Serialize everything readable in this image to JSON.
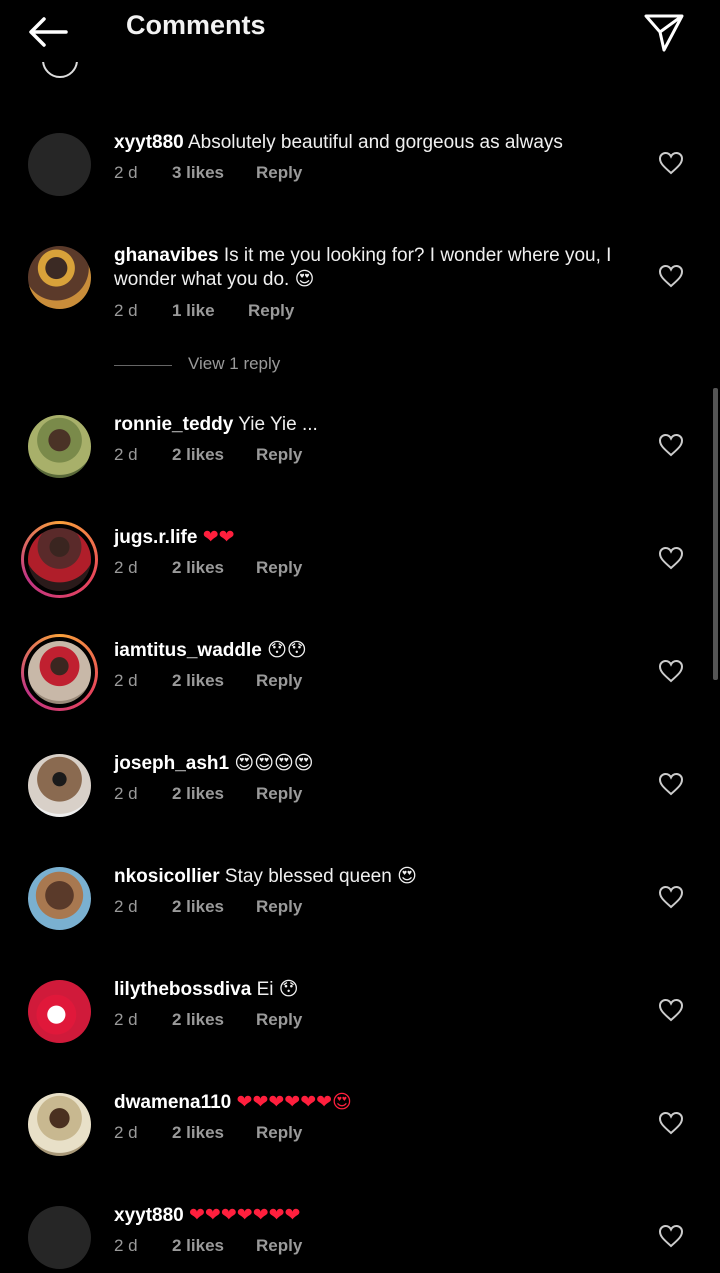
{
  "header": {
    "title": "Comments"
  },
  "view_replies_label": "View 1 reply",
  "comments": [
    {
      "user": "xyyt880",
      "text": "Absolutely beautiful and gorgeous as always",
      "time": "2 d",
      "likes": "3 likes",
      "reply": "Reply"
    },
    {
      "user": "ghanavibes",
      "text": "Is it me you looking for? I wonder where you, I wonder what you do. 😍",
      "time": "2 d",
      "likes": "1 like",
      "reply": "Reply"
    },
    {
      "user": "ronnie_teddy",
      "text": "Yie Yie ...",
      "time": "2 d",
      "likes": "2 likes",
      "reply": "Reply"
    },
    {
      "user": "jugs.r.life",
      "text": "❤❤",
      "time": "2 d",
      "likes": "2 likes",
      "reply": "Reply"
    },
    {
      "user": "iamtitus_waddle",
      "text": "😯😯",
      "time": "2 d",
      "likes": "2 likes",
      "reply": "Reply"
    },
    {
      "user": "joseph_ash1",
      "text": "😍😍😍😍",
      "time": "2 d",
      "likes": "2 likes",
      "reply": "Reply"
    },
    {
      "user": "nkosicollier",
      "text": "Stay blessed queen 😍",
      "time": "2 d",
      "likes": "2 likes",
      "reply": "Reply"
    },
    {
      "user": "lilythebossdiva",
      "text": "Ei 😯",
      "time": "2 d",
      "likes": "2 likes",
      "reply": "Reply"
    },
    {
      "user": "dwamena110",
      "text": "❤❤❤❤❤❤😍",
      "time": "2 d",
      "likes": "2 likes",
      "reply": "Reply"
    },
    {
      "user": "xyyt880",
      "text": "❤❤❤❤❤❤❤",
      "time": "2 d",
      "likes": "2 likes",
      "reply": "Reply"
    }
  ],
  "colors": {
    "background": "#000000",
    "meta_text": "#9a9a9a",
    "heart": "#ff1f3d",
    "story_ring": "#e8455a"
  }
}
